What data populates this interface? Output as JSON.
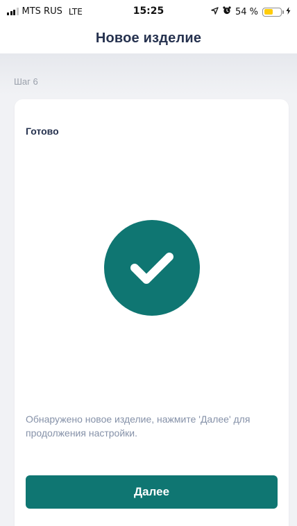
{
  "status_bar": {
    "carrier": "MTS RUS",
    "network": "LTE",
    "time": "15:25",
    "battery_percent_text": "54 %",
    "battery_level": 0.54,
    "battery_color": "#ffcc0a",
    "icons": [
      "signal-icon",
      "location-icon",
      "alarm-icon",
      "battery-icon",
      "charging-icon"
    ]
  },
  "header": {
    "title": "Новое изделие"
  },
  "step": {
    "label": "Шаг 6"
  },
  "card": {
    "title": "Готово",
    "icon": "check-circle-icon",
    "message": "Обнаружено новое изделие, нажмите 'Далее' для продолжения настройки.",
    "next_label": "Далее"
  },
  "colors": {
    "accent": "#0f7672",
    "title": "#26324f",
    "muted_text": "#8591a8",
    "background": "#f1f2f5"
  }
}
